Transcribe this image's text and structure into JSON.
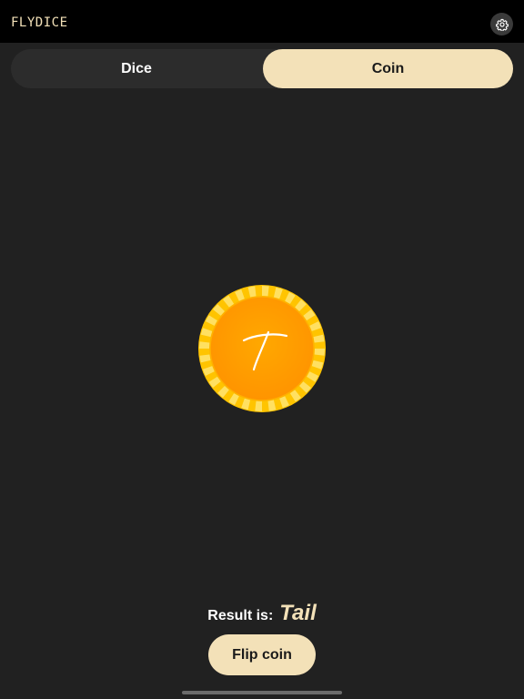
{
  "app": {
    "title": "FLYDICE"
  },
  "header": {
    "settings_icon": "gear-icon"
  },
  "mode_tabs": [
    {
      "label": "Dice",
      "selected": false
    },
    {
      "label": "Coin",
      "selected": true
    }
  ],
  "coin": {
    "face_letter": "T",
    "face": "tail"
  },
  "result": {
    "label": "Result is:",
    "value": "Tail"
  },
  "actions": {
    "flip_label": "Flip coin"
  },
  "colors": {
    "background": "#212121",
    "topbar": "#000000",
    "accent": "#f3e1b8",
    "coin_outer": "#ffc400",
    "coin_inner": "#ffa000"
  }
}
